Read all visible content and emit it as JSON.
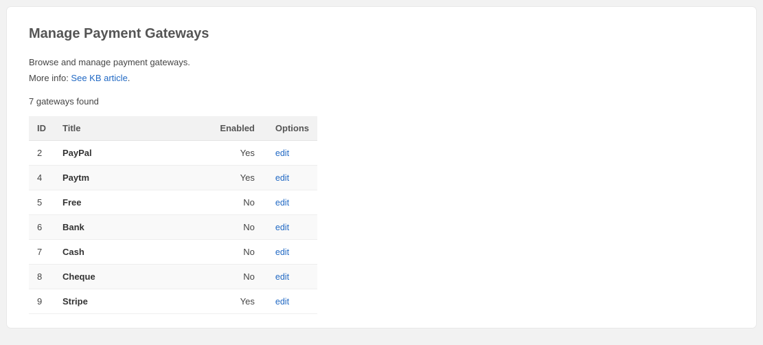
{
  "title": "Manage Payment Gateways",
  "intro": {
    "line1": "Browse and manage payment gateways.",
    "more_prefix": "More info: ",
    "link_text": "See KB article",
    "suffix": "."
  },
  "count_text": "7 gateways found",
  "columns": {
    "id": "ID",
    "title": "Title",
    "enabled": "Enabled",
    "options": "Options"
  },
  "edit_label": "edit",
  "rows": [
    {
      "id": "2",
      "title": "PayPal",
      "enabled": "Yes"
    },
    {
      "id": "4",
      "title": "Paytm",
      "enabled": "Yes"
    },
    {
      "id": "5",
      "title": "Free",
      "enabled": "No"
    },
    {
      "id": "6",
      "title": "Bank",
      "enabled": "No"
    },
    {
      "id": "7",
      "title": "Cash",
      "enabled": "No"
    },
    {
      "id": "8",
      "title": "Cheque",
      "enabled": "No"
    },
    {
      "id": "9",
      "title": "Stripe",
      "enabled": "Yes"
    }
  ]
}
